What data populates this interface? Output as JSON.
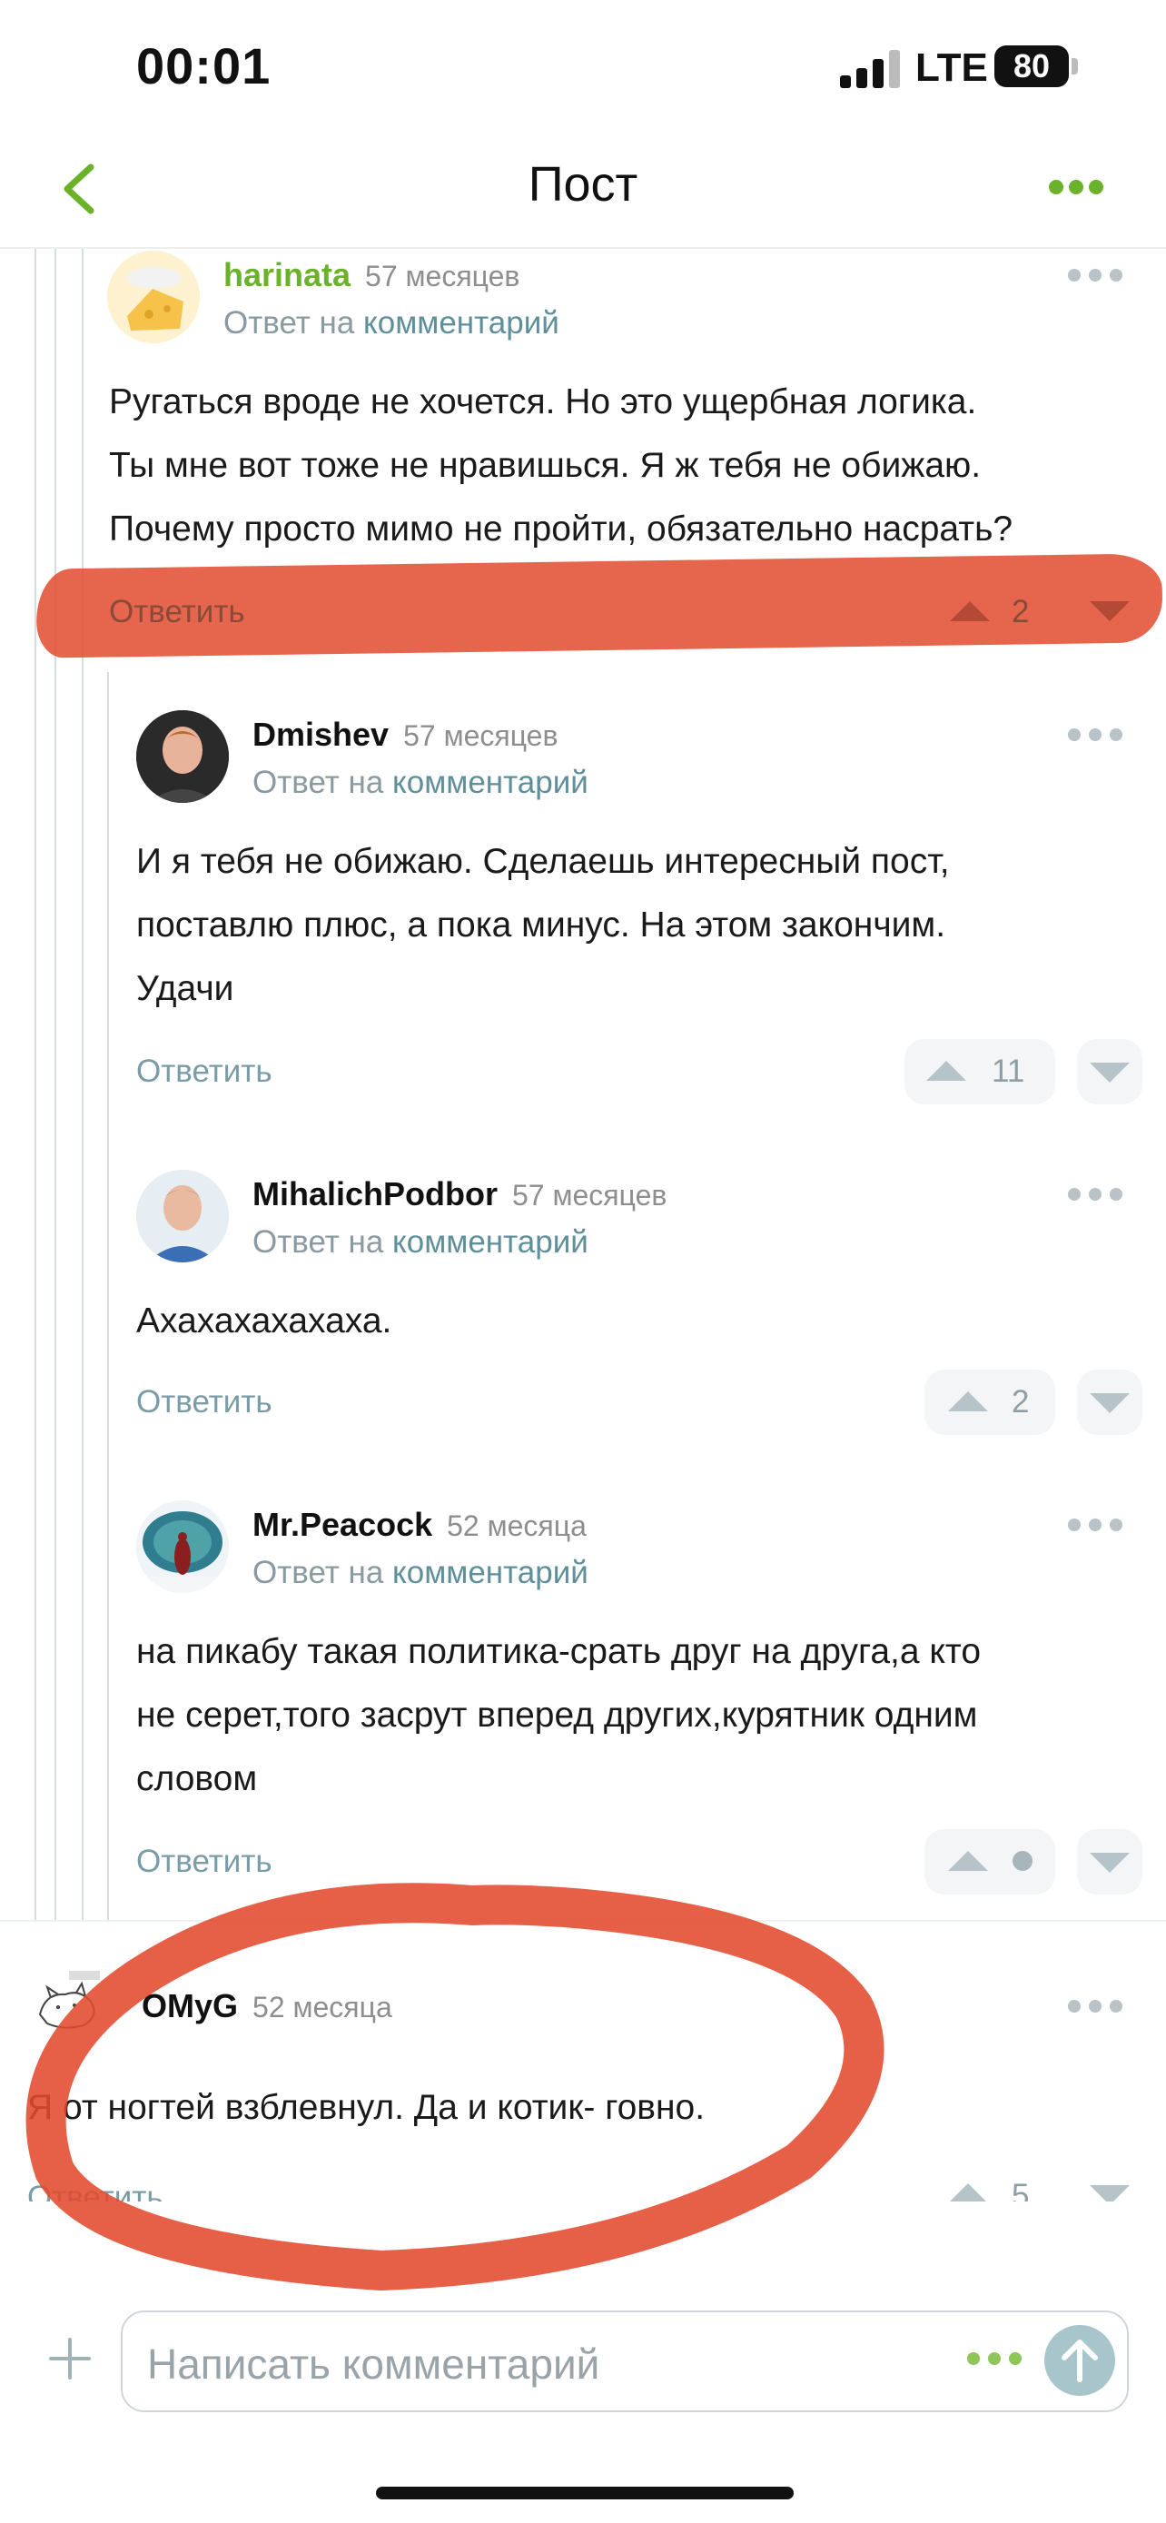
{
  "status_bar": {
    "time": "00:01",
    "network": "LTE",
    "battery": "80"
  },
  "nav": {
    "title": "Пост"
  },
  "reply_to_prefix": "Ответ на",
  "reply_to_link": "комментарий",
  "reply_label": "Ответить",
  "comments": [
    {
      "user": "harinata",
      "ago": "57 месяцев",
      "lines": [
        "Ругаться вроде не хочется. Но это ущербная логика.",
        "Ты мне вот тоже не нравишься. Я ж тебя не обижаю.",
        "Почему просто мимо не пройти, обязательно насрать?"
      ],
      "votes": "2"
    },
    {
      "user": "Dmishev",
      "ago": "57 месяцев",
      "lines": [
        "И я тебя не обижаю. Сделаешь интересный пост,",
        "поставлю плюс, а пока минус. На этом закончим.",
        "Удачи"
      ],
      "votes": "11"
    },
    {
      "user": "MihalichPodbor",
      "ago": "57 месяцев",
      "lines": [
        "Ахахахахахаха."
      ],
      "votes": "2"
    },
    {
      "user": "Mr.Peacock",
      "ago": "52 месяца",
      "lines": [
        "на пикабу такая политика-срать друг на друга,а кто",
        "не серет,того засрут вперед других,курятник одним",
        "словом"
      ],
      "votes": ""
    },
    {
      "user": "OMyG",
      "ago": "52 месяца",
      "lines": [
        "Я от ногтей взблевнул. Да и котик- говно."
      ],
      "votes": "5"
    }
  ],
  "composer": {
    "placeholder": "Написать комментарий"
  },
  "colors": {
    "brand_green": "#6bb22b",
    "marker_red": "#e24a2e",
    "link_blue_gray": "#5f8f9a"
  }
}
